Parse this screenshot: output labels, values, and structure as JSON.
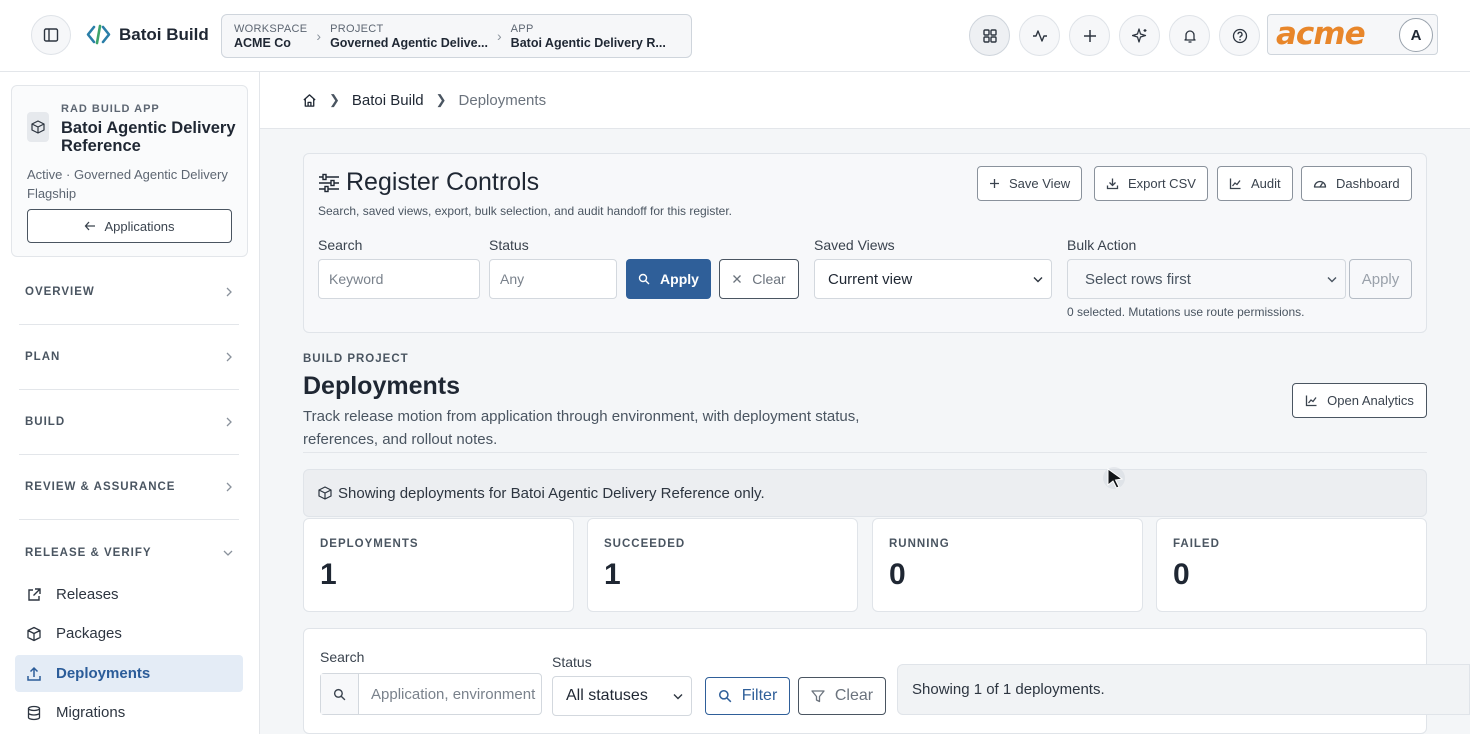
{
  "header": {
    "brand": "Batoi Build",
    "crumbs": [
      {
        "label": "WORKSPACE",
        "value": "ACME Co"
      },
      {
        "label": "PROJECT",
        "value": "Governed Agentic Delive..."
      },
      {
        "label": "APP",
        "value": "Batoi Agentic Delivery R..."
      }
    ],
    "icons": [
      "apps-grid-icon",
      "activity-icon",
      "plus-icon",
      "sparkle-icon",
      "bell-icon",
      "help-icon"
    ],
    "org_logo_text": "acme",
    "avatar_initial": "A",
    "accent_color": "#e8862a"
  },
  "sidebar": {
    "app_card": {
      "kicker": "RAD BUILD APP",
      "title": "Batoi Agentic Delivery Reference",
      "meta": "Active · Governed Agentic Delivery Flagship",
      "back_label": "Applications"
    },
    "sections": [
      "OVERVIEW",
      "PLAN",
      "BUILD",
      "REVIEW & ASSURANCE",
      "RELEASE & VERIFY"
    ],
    "items": [
      {
        "label": "Releases",
        "icon": "external-link-icon"
      },
      {
        "label": "Packages",
        "icon": "package-icon"
      },
      {
        "label": "Deployments",
        "icon": "upload-icon"
      },
      {
        "label": "Migrations",
        "icon": "database-icon"
      }
    ],
    "active_color": "#2b5c99"
  },
  "breadcrumb": {
    "items": [
      "Batoi Build",
      "Deployments"
    ]
  },
  "register": {
    "title": "Register Controls",
    "subtitle": "Search, saved views, export, bulk selection, and audit handoff for this register.",
    "buttons": {
      "save_view": "Save View",
      "export_csv": "Export CSV",
      "audit": "Audit",
      "dashboard": "Dashboard"
    },
    "search_label": "Search",
    "search_placeholder": "Keyword",
    "status_label": "Status",
    "status_placeholder": "Any",
    "apply": "Apply",
    "clear": "Clear",
    "saved_views_label": "Saved Views",
    "saved_view_value": "Current view",
    "bulk_label": "Bulk Action",
    "bulk_value": "Select rows first",
    "bulk_apply": "Apply",
    "bulk_note": "0 selected. Mutations use route permissions."
  },
  "page": {
    "kicker": "BUILD PROJECT",
    "title": "Deployments",
    "description": "Track release motion from application through environment, with deployment status, references, and rollout notes.",
    "analytics": "Open Analytics",
    "scope_note": "Showing deployments for Batoi Agentic Delivery Reference only."
  },
  "stats": [
    {
      "label": "DEPLOYMENTS",
      "value": "1"
    },
    {
      "label": "SUCCEEDED",
      "value": "1"
    },
    {
      "label": "RUNNING",
      "value": "0"
    },
    {
      "label": "FAILED",
      "value": "0"
    }
  ],
  "filters": {
    "search_label": "Search",
    "search_placeholder": "Application, environment",
    "status_label": "Status",
    "status_value": "All statuses",
    "filter": "Filter",
    "clear": "Clear",
    "showing": "Showing 1 of 1 deployments."
  },
  "colors": {
    "primary": "#2f5f99"
  }
}
